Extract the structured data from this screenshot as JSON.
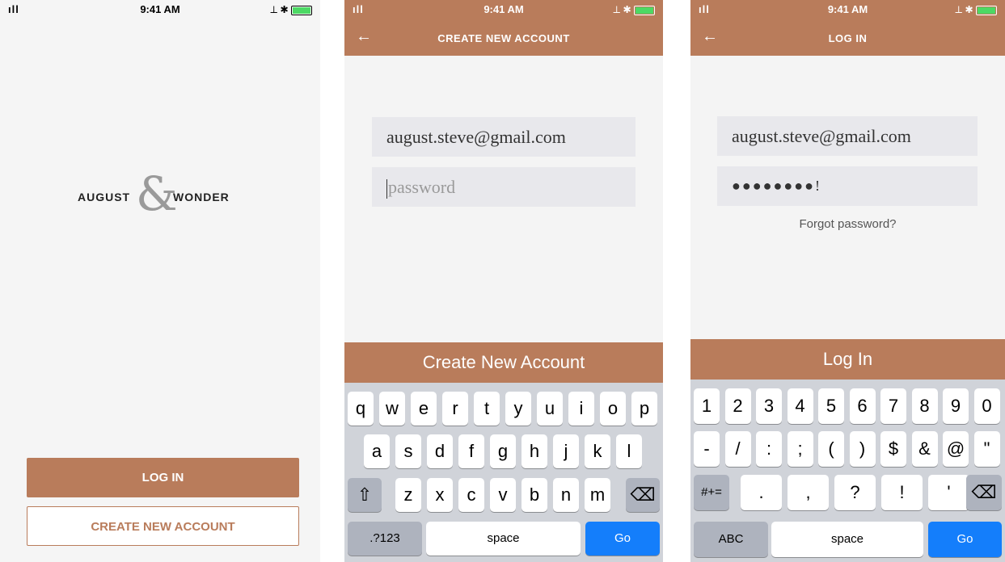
{
  "status": {
    "time": "9:41 AM",
    "signal": "ıll",
    "icons": "⟂ ✱"
  },
  "screen1": {
    "logo": {
      "left": "AUGUST",
      "amp": "&",
      "right": "WONDER"
    },
    "login_button": "LOG IN",
    "create_button": "CREATE NEW ACCOUNT"
  },
  "screen2": {
    "title": "CREATE NEW ACCOUNT",
    "back_icon": "←",
    "email_value": "august.steve@gmail.com",
    "password_placeholder": "password",
    "cta": "Create New Account",
    "keyboard": {
      "row1": [
        "q",
        "w",
        "e",
        "r",
        "t",
        "y",
        "u",
        "i",
        "o",
        "p"
      ],
      "row2": [
        "a",
        "s",
        "d",
        "f",
        "g",
        "h",
        "j",
        "k",
        "l"
      ],
      "row3": [
        "z",
        "x",
        "c",
        "v",
        "b",
        "n",
        "m"
      ],
      "shift": "⇧",
      "delete": "⌫",
      "mode": ".?123",
      "space": "space",
      "go": "Go"
    }
  },
  "screen3": {
    "title": "LOG IN",
    "back_icon": "←",
    "email_value": "august.steve@gmail.com",
    "password_value": "●●●●●●●●!",
    "forgot": "Forgot password?",
    "cta": "Log In",
    "keyboard": {
      "row1": [
        "1",
        "2",
        "3",
        "4",
        "5",
        "6",
        "7",
        "8",
        "9",
        "0"
      ],
      "row2": [
        "-",
        "/",
        ":",
        ";",
        "(",
        ")",
        "$",
        "&",
        "@",
        "\""
      ],
      "row3": [
        ".",
        ",",
        "?",
        "!",
        "'"
      ],
      "symbols": "#+=",
      "delete": "⌫",
      "mode": "ABC",
      "space": "space",
      "go": "Go"
    }
  },
  "colors": {
    "brand": "#b97c5b",
    "go": "#147efb"
  }
}
